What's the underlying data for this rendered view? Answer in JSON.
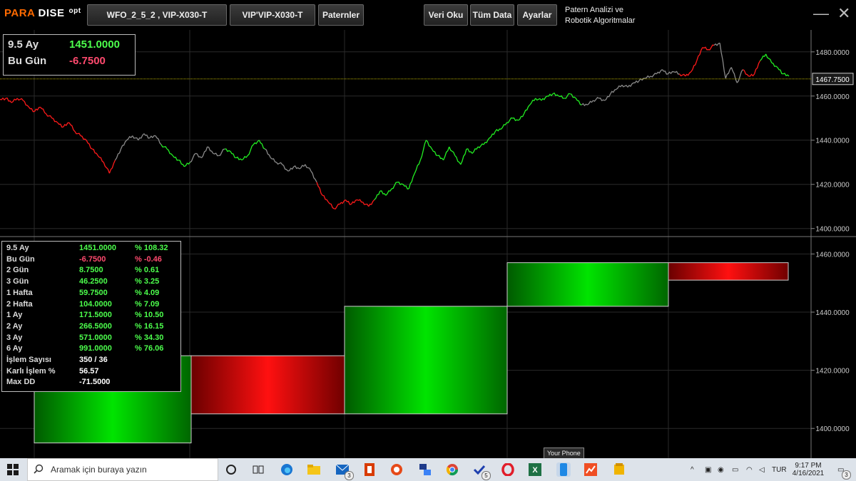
{
  "app": {
    "logo_part1": "PARA",
    "logo_part2": " DISE",
    "logo_suffix": "opt",
    "subtitle_line1": "Patern Analizi ve",
    "subtitle_line2": "Robotik Algoritmalar"
  },
  "toolbar": {
    "strategy_label": "WFO_2_5_2  ,  VIP-X030-T",
    "symbol_label": "VIP'VIP-X030-T",
    "patterns_label": "Paternler",
    "load_data_label": "Veri Oku",
    "all_data_label": "Tüm Data",
    "settings_label": "Ayarlar",
    "minimize_glyph": "—",
    "close_glyph": "✕"
  },
  "summary": {
    "period_label": "9.5 Ay",
    "period_value": "1451.0000",
    "today_label": "Bu Gün",
    "today_value": "-6.7500"
  },
  "price_axis": {
    "ticks": [
      "1480.0000",
      "1460.0000",
      "1440.0000",
      "1420.0000",
      "1400.0000"
    ],
    "current_price": "1467.7500"
  },
  "lower_axis": {
    "ticks": [
      "1460.0000",
      "1440.0000",
      "1420.0000",
      "1400.0000"
    ]
  },
  "stats": {
    "rows": [
      {
        "label": "9.5 Ay",
        "value": "1451.0000",
        "pct": "% 108.32"
      },
      {
        "label": "Bu Gün",
        "value": "-6.7500",
        "pct": "% -0.46"
      },
      {
        "label": "2 Gün",
        "value": "8.7500",
        "pct": "% 0.61"
      },
      {
        "label": "3 Gün",
        "value": "46.2500",
        "pct": "% 3.25"
      },
      {
        "label": "1 Hafta",
        "value": "59.7500",
        "pct": "% 4.09"
      },
      {
        "label": "2 Hafta",
        "value": "104.0000",
        "pct": "% 7.09"
      },
      {
        "label": "1 Ay",
        "value": "171.5000",
        "pct": "% 10.50"
      },
      {
        "label": "2 Ay",
        "value": "266.5000",
        "pct": "% 16.15"
      },
      {
        "label": "3 Ay",
        "value": "571.0000",
        "pct": "% 34.30"
      },
      {
        "label": "6 Ay",
        "value": "991.0000",
        "pct": "% 76.06"
      }
    ],
    "trade_count_label": "İşlem Sayısı",
    "trade_count_value": "350 / 36",
    "win_rate_label": "Karlı İşlem %",
    "win_rate_value": "56.57",
    "max_dd_label": "Max DD",
    "max_dd_value": "-71.5000"
  },
  "chart_data": {
    "type": "line",
    "price_series": {
      "ylim": [
        1397,
        1488
      ],
      "points": [
        1458.5,
        1459,
        1457,
        1459,
        1458,
        1455,
        1453,
        1455,
        1452,
        1450,
        1448,
        1446,
        1448,
        1444,
        1442,
        1440,
        1436,
        1433,
        1430,
        1425,
        1431,
        1436,
        1440,
        1442,
        1440,
        1443,
        1441,
        1442,
        1438,
        1436,
        1433,
        1431,
        1428,
        1430,
        1434,
        1432,
        1437,
        1434,
        1433,
        1436,
        1435,
        1432,
        1431,
        1433,
        1438,
        1440,
        1436,
        1432,
        1430,
        1429,
        1426,
        1428,
        1427,
        1429,
        1426,
        1421,
        1415,
        1412,
        1409,
        1411,
        1413,
        1411,
        1413,
        1412,
        1410,
        1413,
        1417,
        1415,
        1418,
        1421,
        1420,
        1418,
        1425,
        1431,
        1440,
        1436,
        1433,
        1431,
        1437,
        1433,
        1429,
        1436,
        1434,
        1437,
        1438,
        1441,
        1444,
        1445,
        1448,
        1450,
        1449,
        1452,
        1456,
        1459,
        1458,
        1460,
        1461,
        1460,
        1459,
        1461,
        1459,
        1456,
        1456,
        1458,
        1459,
        1458,
        1461,
        1463,
        1465,
        1464,
        1466,
        1467,
        1468,
        1469,
        1470,
        1472,
        1470,
        1471,
        1470,
        1469,
        1471,
        1476,
        1482,
        1481,
        1483,
        1484,
        1468,
        1473,
        1466,
        1472,
        1469,
        1470,
        1476,
        1479,
        1475,
        1473,
        1470,
        1469
      ],
      "segment_colors": [
        "red",
        "red",
        "red",
        "red",
        "red",
        "red",
        "red",
        "red",
        "red",
        "red",
        "red",
        "red",
        "red",
        "red",
        "red",
        "red",
        "red",
        "red",
        "red",
        "red",
        "gray",
        "gray",
        "gray",
        "gray",
        "gray",
        "gray",
        "gray",
        "gray",
        "green",
        "green",
        "green",
        "green",
        "green",
        "gray",
        "gray",
        "gray",
        "gray",
        "gray",
        "gray",
        "green",
        "green",
        "green",
        "green",
        "green",
        "green",
        "green",
        "gray",
        "gray",
        "gray",
        "gray",
        "gray",
        "gray",
        "gray",
        "gray",
        "gray",
        "red",
        "red",
        "red",
        "red",
        "red",
        "red",
        "red",
        "red",
        "red",
        "red",
        "green",
        "green",
        "green",
        "green",
        "green",
        "green",
        "green",
        "green",
        "green",
        "green",
        "green",
        "green",
        "green",
        "green",
        "green",
        "green",
        "green",
        "green",
        "green",
        "green",
        "green",
        "green",
        "green",
        "green",
        "green",
        "green",
        "green",
        "green",
        "green",
        "green",
        "green",
        "green",
        "green",
        "green",
        "green",
        "green",
        "gray",
        "gray",
        "gray",
        "gray",
        "gray",
        "gray",
        "gray",
        "gray",
        "gray",
        "gray",
        "gray",
        "gray",
        "gray",
        "gray",
        "gray",
        "gray",
        "gray",
        "red",
        "red",
        "red",
        "red",
        "red",
        "red",
        "gray",
        "gray",
        "gray",
        "gray",
        "gray",
        "red",
        "red",
        "red",
        "green",
        "green",
        "green",
        "green",
        "green",
        "green",
        "red",
        "red"
      ]
    },
    "blocks": {
      "ylim": [
        1390,
        1465
      ],
      "bars": [
        {
          "open": 1395,
          "close": 1425,
          "color": "green"
        },
        {
          "open": 1425,
          "close": 1405,
          "color": "red"
        },
        {
          "open": 1405,
          "close": 1442,
          "color": "green"
        },
        {
          "open": 1442,
          "close": 1457,
          "color": "green"
        },
        {
          "open": 1457,
          "close": 1451,
          "color": "red"
        }
      ]
    }
  },
  "taskbar": {
    "search_placeholder": "Aramak için buraya yazın",
    "tooltip": "Your Phone",
    "time": "9:17 PM",
    "date": "4/16/2021",
    "language": "TUR",
    "mail_badge": "3",
    "todo_badge": "5",
    "notification_count": "3"
  }
}
